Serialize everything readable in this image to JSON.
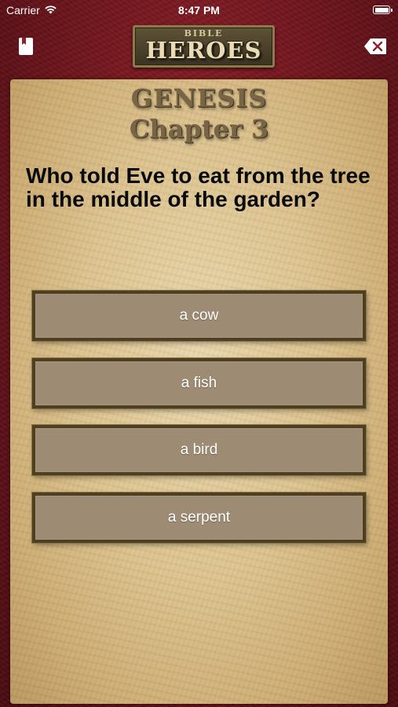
{
  "status_bar": {
    "carrier": "Carrier",
    "time": "8:47 PM"
  },
  "nav": {
    "logo_top": "BIBLE",
    "logo_bottom": "HEROES",
    "bookmark_icon": "bookmark-icon",
    "close_icon": "delete-backspace-icon"
  },
  "quiz": {
    "book": "GENESIS",
    "chapter": "Chapter 3",
    "question": "Who told Eve to eat from the tree in the middle of the garden?",
    "answers": [
      {
        "label": "a cow"
      },
      {
        "label": "a fish"
      },
      {
        "label": "a bird"
      },
      {
        "label": "a serpent"
      }
    ]
  },
  "colors": {
    "leather": "#6b131b",
    "parchment": "#dcc28e",
    "answer_fill": "#9e8b73",
    "answer_border": "#4e3f21",
    "title_text": "#786546"
  }
}
